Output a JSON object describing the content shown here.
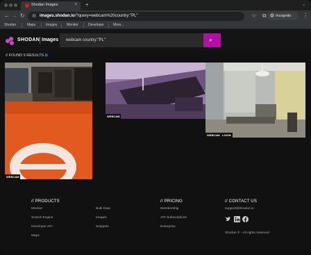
{
  "browser": {
    "tab_title": "Shodan Images",
    "tab_close": "×",
    "new_tab": "+",
    "url_host": "images.shodan.io",
    "url_path": "/?query=webcam%20country:\"PL\"",
    "mode_label": "Incognito",
    "bookmarks": [
      "Shodan",
      "Maps",
      "Images",
      "Monitor",
      "Developer",
      "More..."
    ]
  },
  "header": {
    "brand": "SHODAN",
    "section": "Images",
    "search_value": "webcam country:\"PL\""
  },
  "results": {
    "found_prefix": "// FOUND ",
    "found_count": "9",
    "found_suffix": " RESULTS",
    "external_icon": "external-link-icon",
    "images": [
      {
        "tag": "WEBCAM"
      },
      {
        "tag": "WEBCAM"
      },
      {
        "tag": "WEBCAM"
      },
      {
        "tag": "LOGIN"
      }
    ]
  },
  "footer": {
    "products_heading": "// PRODUCTS",
    "products": [
      "Monitor",
      "Search Engine",
      "Developer API",
      "Maps",
      "Bulk Data",
      "Images",
      "Snippets"
    ],
    "pricing_heading": "// PRICING",
    "pricing": [
      "Membership",
      "API Subscriptions",
      "Enterprise"
    ],
    "contact_heading": "// CONTACT US",
    "email": "support@shodan.io",
    "copyright": "Shodan ® - All rights reserved"
  },
  "colors": {
    "accent": "#b50ea6",
    "logo": "#c84bc1"
  }
}
